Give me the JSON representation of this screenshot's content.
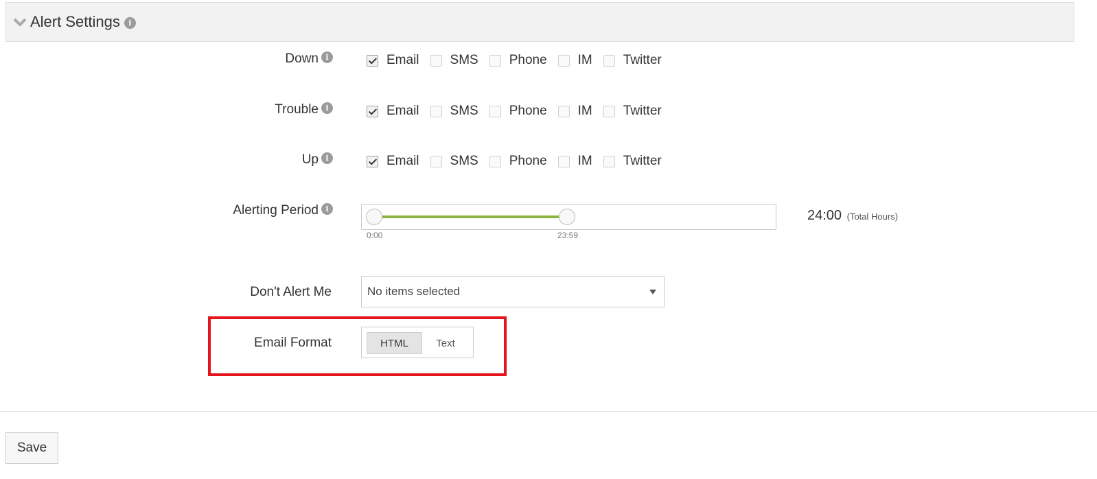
{
  "section": {
    "title": "Alert Settings",
    "info_icon": "i"
  },
  "rows": [
    {
      "label": "Down",
      "channels": [
        {
          "label": "Email",
          "checked": true
        },
        {
          "label": "SMS",
          "checked": false
        },
        {
          "label": "Phone",
          "checked": false
        },
        {
          "label": "IM",
          "checked": false
        },
        {
          "label": "Twitter",
          "checked": false
        }
      ]
    },
    {
      "label": "Trouble",
      "channels": [
        {
          "label": "Email",
          "checked": true
        },
        {
          "label": "SMS",
          "checked": false
        },
        {
          "label": "Phone",
          "checked": false
        },
        {
          "label": "IM",
          "checked": false
        },
        {
          "label": "Twitter",
          "checked": false
        }
      ]
    },
    {
      "label": "Up",
      "channels": [
        {
          "label": "Email",
          "checked": true
        },
        {
          "label": "SMS",
          "checked": false
        },
        {
          "label": "Phone",
          "checked": false
        },
        {
          "label": "IM",
          "checked": false
        },
        {
          "label": "Twitter",
          "checked": false
        }
      ]
    }
  ],
  "alerting_period": {
    "label": "Alerting Period",
    "start": "0:00",
    "end": "23:59",
    "total": "24:00",
    "total_suffix": "(Total Hours)"
  },
  "dont_alert": {
    "label": "Don't Alert Me",
    "value": "No items selected"
  },
  "email_format": {
    "label": "Email Format",
    "options": [
      "HTML",
      "Text"
    ],
    "selected": "HTML"
  },
  "save_label": "Save",
  "colors": {
    "slider_fill": "#8bb542",
    "highlight": "#e3141c"
  },
  "icons": {
    "collapse": "chevron-down-icon",
    "info": "info-icon",
    "dropdown": "caret-down-icon"
  }
}
